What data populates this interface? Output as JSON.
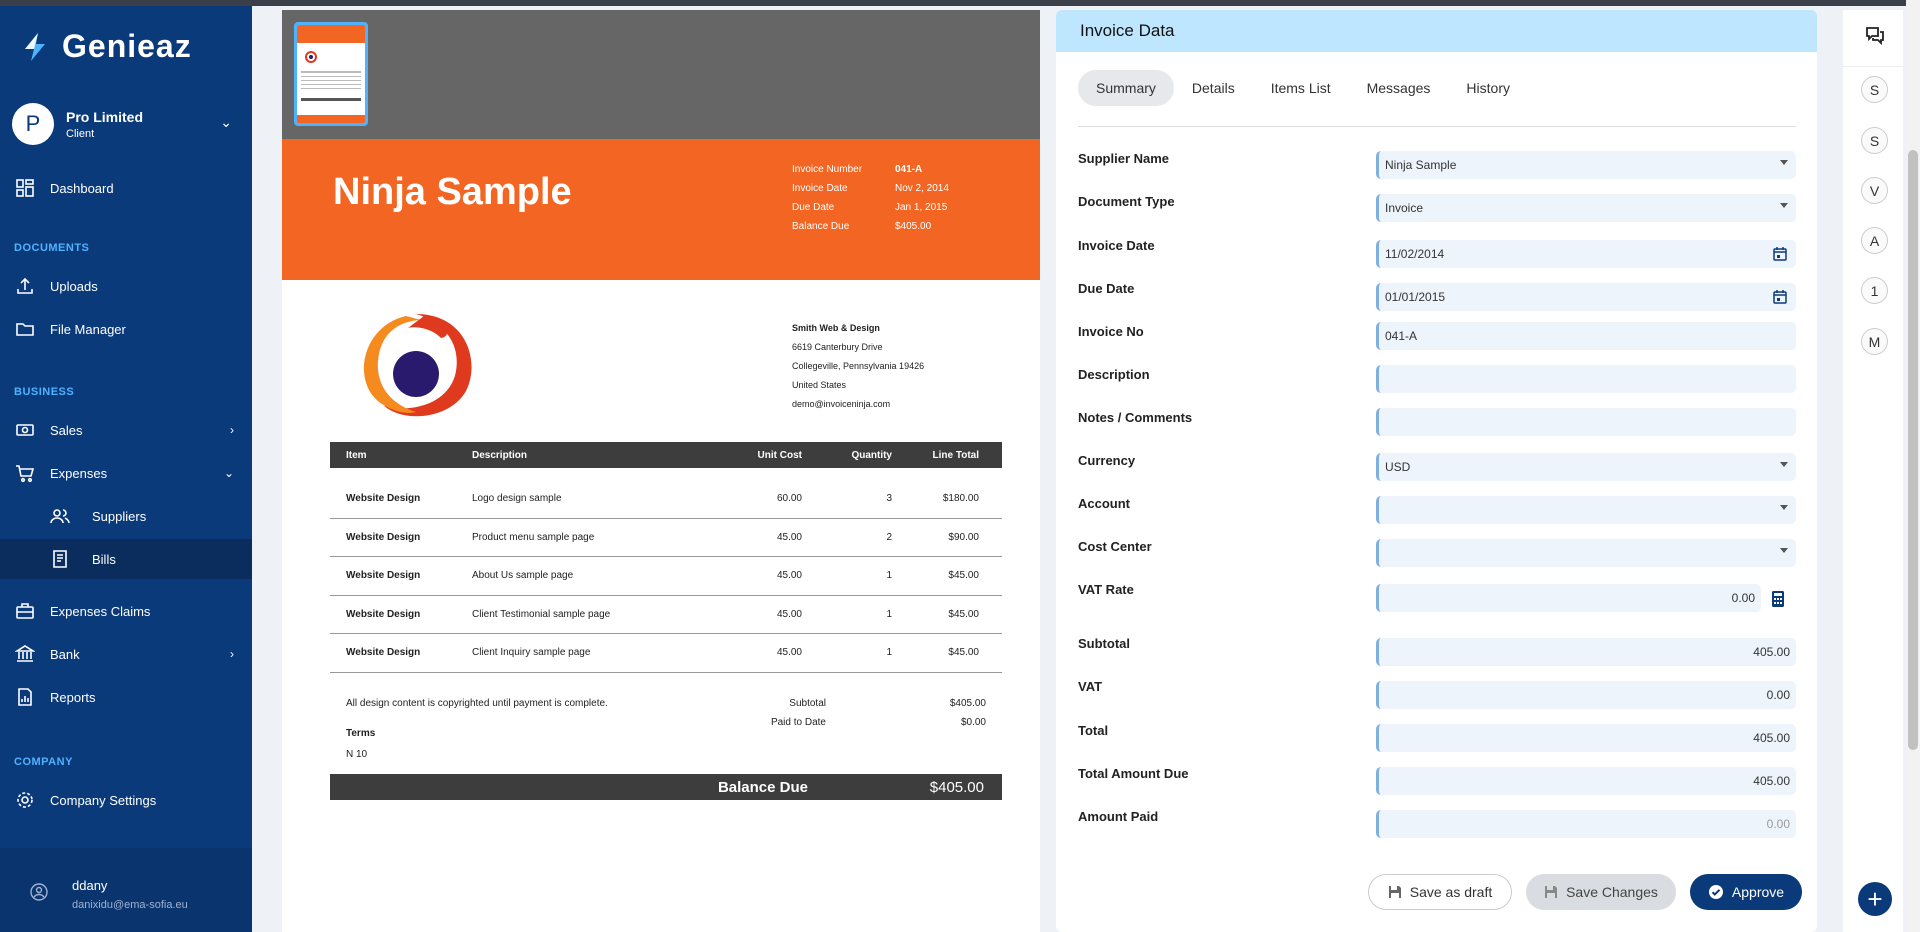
{
  "app": {
    "name": "Genieaz"
  },
  "profile": {
    "initial": "P",
    "name": "Pro Limited",
    "role": "Client"
  },
  "sidebar": {
    "dashboard": "Dashboard",
    "sec_documents": "DOCUMENTS",
    "uploads": "Uploads",
    "file_manager": "File Manager",
    "sec_business": "BUSINESS",
    "sales": "Sales",
    "expenses": "Expenses",
    "suppliers": "Suppliers",
    "bills": "Bills",
    "expenses_claims": "Expenses Claims",
    "bank": "Bank",
    "reports": "Reports",
    "sec_company": "COMPANY",
    "company_settings": "Company Settings"
  },
  "user": {
    "name": "ddany",
    "email": "danixidu@ema-sofia.eu"
  },
  "invoice": {
    "title": "Ninja Sample",
    "meta": [
      {
        "k": "Invoice Number",
        "v": "041-A"
      },
      {
        "k": "Invoice Date",
        "v": "Nov 2, 2014"
      },
      {
        "k": "Due Date",
        "v": "Jan 1, 2015"
      },
      {
        "k": "Balance Due",
        "v": "$405.00"
      }
    ],
    "company": [
      "Smith Web & Design",
      "6619 Canterbury Drive",
      "Collegeville, Pennsylvania 19426",
      "United States",
      "demo@invoiceninja.com"
    ],
    "headers": [
      "Item",
      "Description",
      "Unit Cost",
      "Quantity",
      "Line Total"
    ],
    "rows": [
      [
        "Website Design",
        "Logo design sample",
        "60.00",
        "3",
        "$180.00"
      ],
      [
        "Website Design",
        "Product menu sample page",
        "45.00",
        "2",
        "$90.00"
      ],
      [
        "Website Design",
        "About Us sample page",
        "45.00",
        "1",
        "$45.00"
      ],
      [
        "Website Design",
        "Client Testimonial sample page",
        "45.00",
        "1",
        "$45.00"
      ],
      [
        "Website Design",
        "Client Inquiry sample page",
        "45.00",
        "1",
        "$45.00"
      ]
    ],
    "notes": "All design content is copyrighted until payment is complete.",
    "terms_label": "Terms",
    "terms_value": "N 10",
    "subtotal_label": "Subtotal",
    "subtotal": "$405.00",
    "paid_label": "Paid to Date",
    "paid": "$0.00",
    "balance_label": "Balance Due",
    "balance": "$405.00"
  },
  "panel": {
    "title": "Invoice Data",
    "tabs": [
      "Summary",
      "Details",
      "Items List",
      "Messages",
      "History"
    ],
    "fields": {
      "supplier_name": {
        "label": "Supplier Name",
        "value": "Ninja Sample"
      },
      "document_type": {
        "label": "Document Type",
        "value": "Invoice"
      },
      "invoice_date": {
        "label": "Invoice Date",
        "value": "11/02/2014"
      },
      "due_date": {
        "label": "Due Date",
        "value": "01/01/2015"
      },
      "invoice_no": {
        "label": "Invoice No",
        "value": "041-A"
      },
      "description": {
        "label": "Description",
        "value": ""
      },
      "notes": {
        "label": "Notes / Comments",
        "value": ""
      },
      "currency": {
        "label": "Currency",
        "value": "USD"
      },
      "account": {
        "label": "Account",
        "value": ""
      },
      "cost_center": {
        "label": "Cost Center",
        "value": ""
      },
      "vat_rate": {
        "label": "VAT Rate",
        "value": "0.00"
      },
      "subtotal": {
        "label": "Subtotal",
        "value": "405.00"
      },
      "vat": {
        "label": "VAT",
        "value": "0.00"
      },
      "total": {
        "label": "Total",
        "value": "405.00"
      },
      "total_due": {
        "label": "Total Amount Due",
        "value": "405.00"
      },
      "amount_paid": {
        "label": "Amount Paid",
        "value": "0.00"
      }
    },
    "buttons": {
      "draft": "Save as draft",
      "save": "Save Changes",
      "approve": "Approve"
    }
  },
  "rail": {
    "badges": [
      "S",
      "S",
      "V",
      "A",
      "1",
      "M"
    ],
    "plus": "+"
  },
  "colors": {
    "sidebar": "#0b3a7a",
    "accent": "#4fb2ff",
    "invoice_orange": "#f26522",
    "panel_header": "#bfe6ff"
  }
}
